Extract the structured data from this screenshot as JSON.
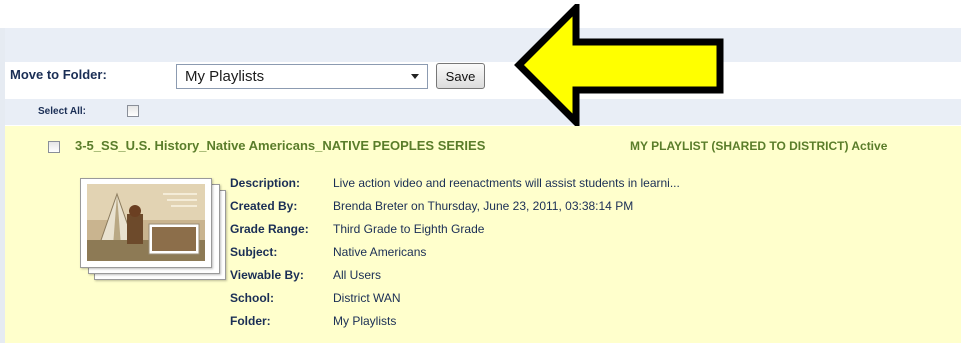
{
  "toolbar": {
    "move_label": "Move to Folder:",
    "folder_selected": "My Playlists",
    "save_label": "Save"
  },
  "select_all": {
    "label": "Select All:"
  },
  "item": {
    "title": "3-5_SS_U.S. History_Native Americans_NATIVE PEOPLES SERIES",
    "meta": "MY PLAYLIST (SHARED TO DISTRICT) Active",
    "details": [
      {
        "label": "Description:",
        "value": "Live action video and reenactments will assist students in learni..."
      },
      {
        "label": "Created By:",
        "value": "Brenda Breter on Thursday, June 23, 2011, 03:38:14 PM"
      },
      {
        "label": "Grade Range:",
        "value": "Third Grade to Eighth Grade"
      },
      {
        "label": "Subject:",
        "value": "Native Americans"
      },
      {
        "label": "Viewable By:",
        "value": "All Users"
      },
      {
        "label": "School:",
        "value": "District WAN"
      },
      {
        "label": "Folder:",
        "value": "My Playlists"
      }
    ]
  },
  "annotation": {
    "arrow_color": "#ffff00",
    "arrow_outline": "#000000"
  }
}
